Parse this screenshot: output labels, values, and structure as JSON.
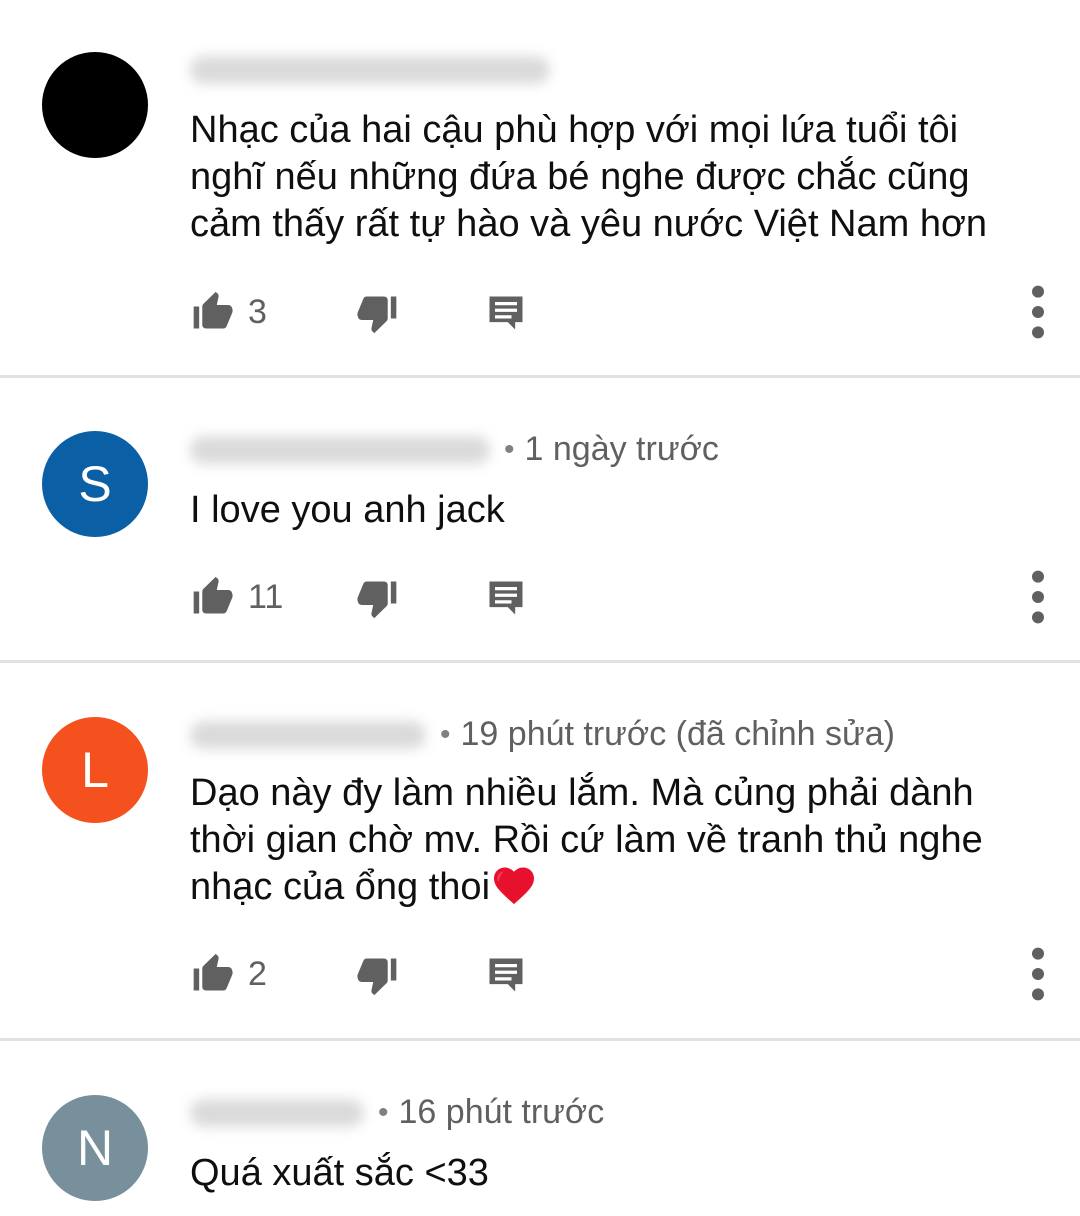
{
  "comments": [
    {
      "avatar_letter": "",
      "avatar_color": "#000000",
      "time": "",
      "text_lines": [
        "Nhạc của hai cậu  phù hợp với mọi lứa tuổi tôi",
        "nghĩ nếu những đứa bé nghe được chắc cũng",
        "cảm thấy rất tự hào và yêu nước Việt Nam hơn"
      ],
      "likes": "3"
    },
    {
      "avatar_letter": "S",
      "avatar_color": "#0b5fa5",
      "time": "1 ngày trước",
      "text_lines": [
        "I love you anh jack"
      ],
      "likes": "11"
    },
    {
      "avatar_letter": "L",
      "avatar_color": "#f4511e",
      "time": "19 phút trước (đã chỉnh sửa)",
      "text_lines": [
        "Dạo này đy làm nhiều lắm. Mà củng phải dành",
        "thời gian chờ mv. Rồi cứ làm về tranh thủ nghe",
        "nhạc của ổng thoi"
      ],
      "likes": "2"
    },
    {
      "avatar_letter": "N",
      "avatar_color": "#78909c",
      "time": "16 phút trước",
      "text_lines": [
        "Quá xuất sắc <33"
      ],
      "likes": ""
    }
  ],
  "icons": {
    "like": "thumb-up-icon",
    "dislike": "thumb-down-icon",
    "reply": "reply-icon",
    "more": "more-vert-icon",
    "heart": "heart-emoji-icon"
  },
  "colors": {
    "icon": "#606060",
    "text": "#0f0f0f",
    "meta": "#606060",
    "divider": "#e2e2e2"
  }
}
